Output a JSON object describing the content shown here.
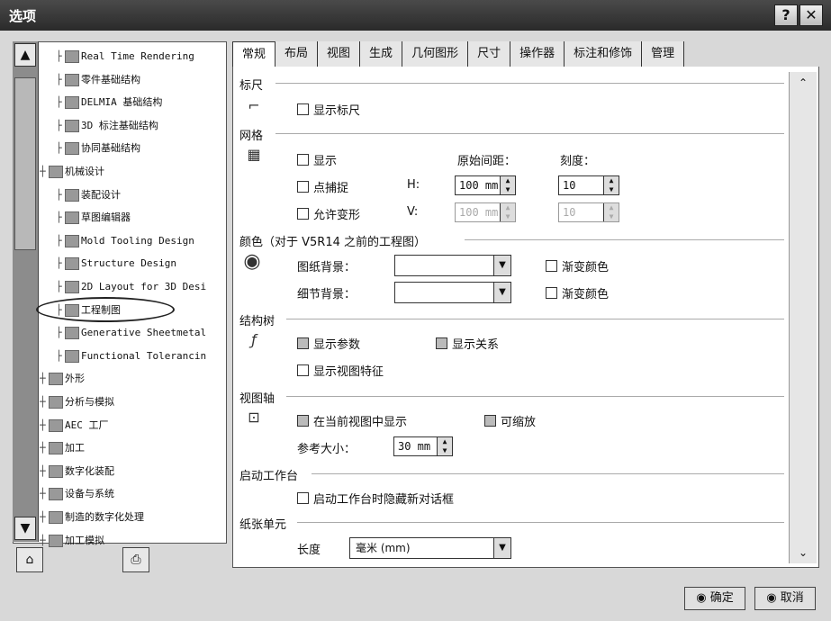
{
  "window": {
    "title": "选项",
    "help_btn": "?",
    "close_btn": "✕"
  },
  "tree": {
    "items": [
      {
        "label": "Real Time Rendering"
      },
      {
        "label": "零件基础结构"
      },
      {
        "label": "DELMIA 基础结构"
      },
      {
        "label": "3D 标注基础结构"
      },
      {
        "label": "协同基础结构"
      },
      {
        "label": "机械设计"
      },
      {
        "label": "装配设计"
      },
      {
        "label": "草图编辑器"
      },
      {
        "label": "Mold Tooling Design"
      },
      {
        "label": "Structure Design"
      },
      {
        "label": "2D Layout for 3D Desi"
      },
      {
        "label": "工程制图"
      },
      {
        "label": "Generative Sheetmetal"
      },
      {
        "label": "Functional Tolerancin"
      },
      {
        "label": "外形"
      },
      {
        "label": "分析与模拟"
      },
      {
        "label": "AEC 工厂"
      },
      {
        "label": "加工"
      },
      {
        "label": "数字化装配"
      },
      {
        "label": "设备与系统"
      },
      {
        "label": "制造的数字化处理"
      },
      {
        "label": "加工模拟"
      }
    ]
  },
  "tabs": [
    "常规",
    "布局",
    "视图",
    "生成",
    "几何图形",
    "尺寸",
    "操作器",
    "标注和修饰",
    "管理"
  ],
  "ruler": {
    "title": "标尺",
    "show_ruler": "显示标尺"
  },
  "grid": {
    "title": "网格",
    "show": "显示",
    "snap": "点捕捉",
    "allow_distortion": "允许变形",
    "primary_spacing": "原始间距：",
    "graduations": "刻度：",
    "h_label": "H:",
    "v_label": "V:",
    "h_spacing": "100 mm",
    "v_spacing": "100 mm",
    "h_grad": "10",
    "v_grad": "10"
  },
  "color": {
    "title": "颜色（对于 V5R14 之前的工程图）",
    "sheet_bg": "图纸背景：",
    "detail_bg": "细节背景：",
    "gradient1": "渐变颜色",
    "gradient2": "渐变颜色"
  },
  "tree_section": {
    "title": "结构树",
    "show_params": "显示参数",
    "show_relations": "显示关系",
    "show_view_features": "显示视图特征"
  },
  "view_axis": {
    "title": "视图轴",
    "display_in_current": "在当前视图中显示",
    "zoomable": "可缩放",
    "ref_size_label": "参考大小：",
    "ref_size": "30 mm"
  },
  "startup": {
    "title": "启动工作台",
    "hide_dialog": "启动工作台时隐藏新对话框"
  },
  "paper_unit": {
    "title": "纸张单元",
    "length_label": "长度",
    "length_value": "毫米 (mm)"
  },
  "footer": {
    "ok": "确定",
    "cancel": "取消"
  }
}
